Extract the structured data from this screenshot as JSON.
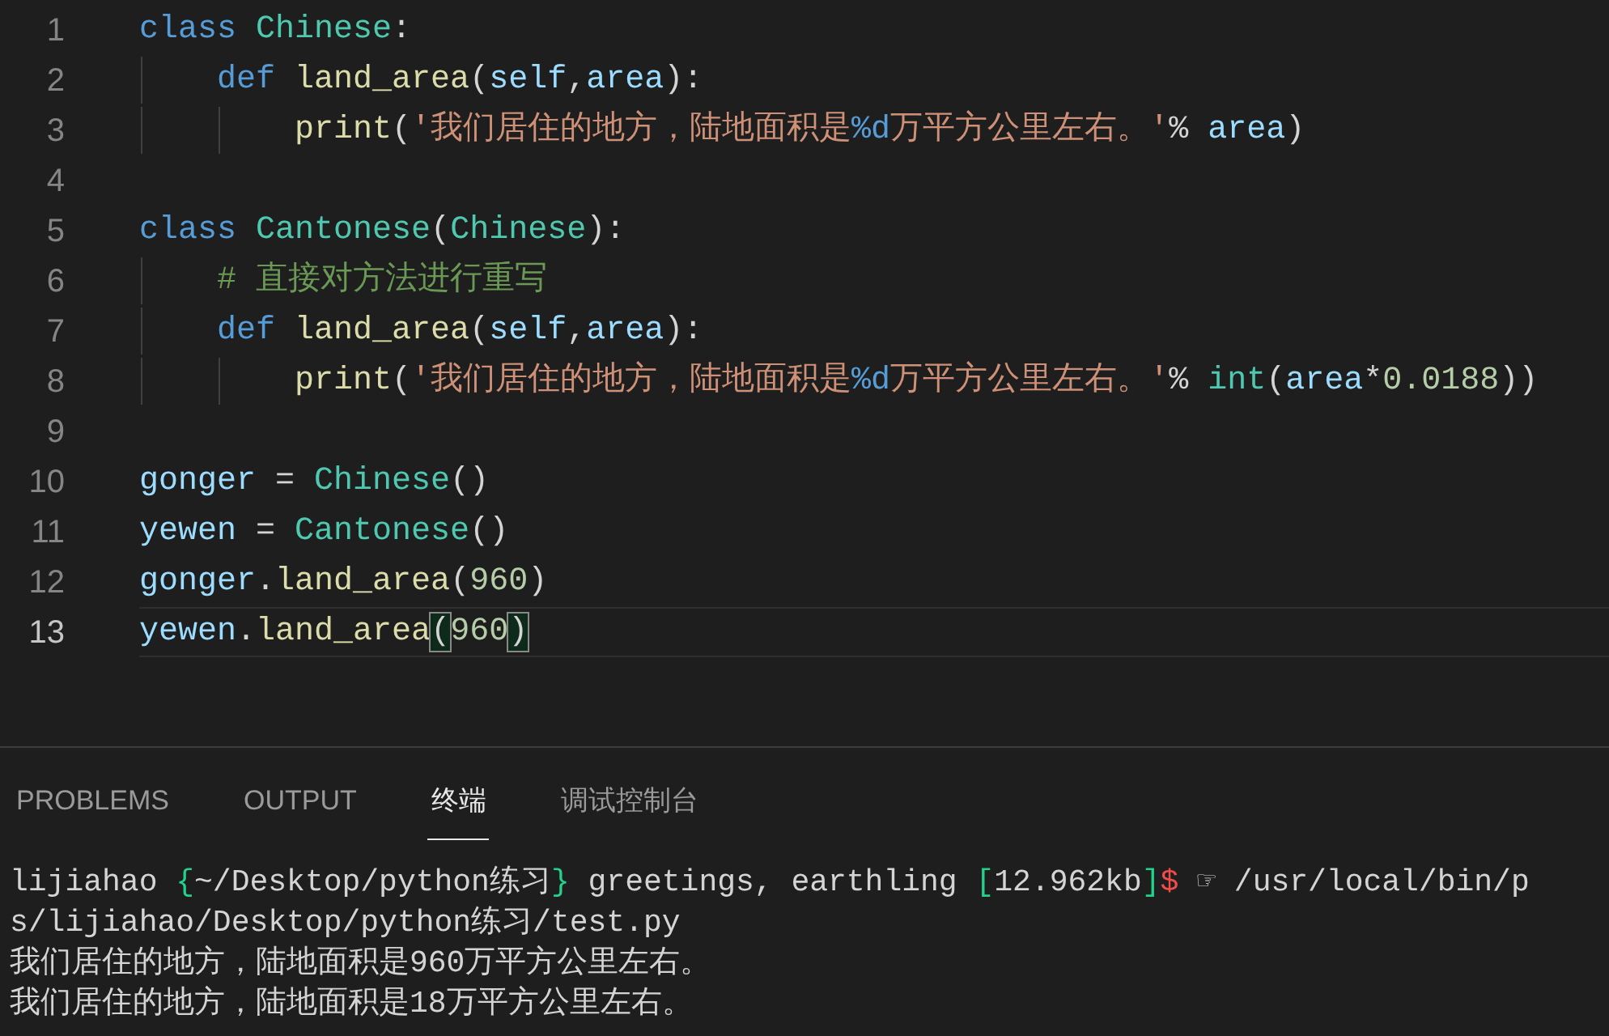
{
  "editor": {
    "lines": [
      {
        "number": "1",
        "current": false,
        "tokens": [
          {
            "text": "class",
            "kind": "keyword"
          },
          {
            "text": " Chinese",
            "kind": "class"
          },
          {
            "text": ":",
            "kind": "plain"
          }
        ],
        "children": [
          {
            "number": "2",
            "current": false,
            "tokens": [
              {
                "text": "def",
                "kind": "keyword"
              },
              {
                "text": " land_area",
                "kind": "func"
              },
              {
                "text": "(",
                "kind": "plain"
              },
              {
                "text": "self",
                "kind": "param"
              },
              {
                "text": ",",
                "kind": "plain"
              },
              {
                "text": "area",
                "kind": "param"
              },
              {
                "text": "):",
                "kind": "plain"
              }
            ],
            "children": [
              {
                "number": "3",
                "current": false,
                "tokens": [
                  {
                    "text": "print",
                    "kind": "func"
                  },
                  {
                    "text": "(",
                    "kind": "plain"
                  },
                  {
                    "text": "'我们居住的地方，陆地面积是",
                    "kind": "string"
                  },
                  {
                    "text": "%d",
                    "kind": "format"
                  },
                  {
                    "text": "万平方公里左右。'",
                    "kind": "string"
                  },
                  {
                    "text": "%",
                    "kind": "plain"
                  },
                  {
                    "text": " area",
                    "kind": "param"
                  },
                  {
                    "text": ")",
                    "kind": "plain"
                  }
                ]
              }
            ]
          }
        ]
      },
      {
        "number": "4",
        "current": false
      },
      {
        "number": "5",
        "current": false,
        "tokens": [
          {
            "text": "class",
            "kind": "keyword"
          },
          {
            "text": " Cantonese",
            "kind": "class"
          },
          {
            "text": "(",
            "kind": "plain"
          },
          {
            "text": "Chinese",
            "kind": "class"
          },
          {
            "text": "):",
            "kind": "plain"
          }
        ],
        "children": [
          {
            "number": "6",
            "current": false,
            "tokens": [
              {
                "text": "# 直接对方法进行重写",
                "kind": "comment"
              }
            ]
          },
          {
            "number": "7",
            "current": false,
            "tokens": [
              {
                "text": "def",
                "kind": "keyword"
              },
              {
                "text": " land_area",
                "kind": "func"
              },
              {
                "text": "(",
                "kind": "plain"
              },
              {
                "text": "self",
                "kind": "param"
              },
              {
                "text": ",",
                "kind": "plain"
              },
              {
                "text": "area",
                "kind": "param"
              },
              {
                "text": "):",
                "kind": "plain"
              }
            ],
            "children": [
              {
                "number": "8",
                "current": false,
                "tokens": [
                  {
                    "text": "print",
                    "kind": "func"
                  },
                  {
                    "text": "(",
                    "kind": "plain"
                  },
                  {
                    "text": "'我们居住的地方，陆地面积是",
                    "kind": "string"
                  },
                  {
                    "text": "%d",
                    "kind": "format"
                  },
                  {
                    "text": "万平方公里左右。'",
                    "kind": "string"
                  },
                  {
                    "text": "%",
                    "kind": "plain"
                  },
                  {
                    "text": " int",
                    "kind": "class"
                  },
                  {
                    "text": "(",
                    "kind": "plain"
                  },
                  {
                    "text": "area",
                    "kind": "param"
                  },
                  {
                    "text": "*",
                    "kind": "plain"
                  },
                  {
                    "text": "0.0188",
                    "kind": "number"
                  },
                  {
                    "text": "))",
                    "kind": "plain"
                  }
                ]
              }
            ]
          }
        ]
      },
      {
        "number": "9",
        "current": false
      },
      {
        "number": "10",
        "current": false,
        "tokens": [
          {
            "text": "gonger",
            "kind": "param"
          },
          {
            "text": " =",
            "kind": "plain"
          },
          {
            "text": " Chinese",
            "kind": "class"
          },
          {
            "text": "()",
            "kind": "plain"
          }
        ]
      },
      {
        "number": "11",
        "current": false,
        "tokens": [
          {
            "text": "yewen",
            "kind": "param"
          },
          {
            "text": " =",
            "kind": "plain"
          },
          {
            "text": " Cantonese",
            "kind": "class"
          },
          {
            "text": "()",
            "kind": "plain"
          }
        ]
      },
      {
        "number": "12",
        "current": false,
        "tokens": [
          {
            "text": "gonger",
            "kind": "param"
          },
          {
            "text": ".",
            "kind": "plain"
          },
          {
            "text": "land_area",
            "kind": "func"
          },
          {
            "text": "(",
            "kind": "plain"
          },
          {
            "text": "960",
            "kind": "number"
          },
          {
            "text": ")",
            "kind": "plain"
          }
        ]
      },
      {
        "number": "13",
        "current": true,
        "tokens": [
          {
            "text": "yewen",
            "kind": "param"
          },
          {
            "text": ".",
            "kind": "plain"
          },
          {
            "text": "land_area",
            "kind": "func"
          },
          {
            "text": "(",
            "kind": "match"
          },
          {
            "text": "960",
            "kind": "number"
          },
          {
            "text": ")",
            "kind": "match"
          }
        ]
      }
    ]
  },
  "panel": {
    "tabs": [
      {
        "label": "PROBLEMS",
        "selected": false
      },
      {
        "label": "OUTPUT",
        "selected": false
      },
      {
        "label": "终端",
        "selected": true
      },
      {
        "label": "调试控制台",
        "selected": false
      }
    ],
    "terminal": [
      [
        {
          "text": "lijiahao",
          "kind": "plain"
        },
        {
          "text": " {",
          "kind": "green"
        },
        {
          "text": "~/Desktop/python练习",
          "kind": "plain"
        },
        {
          "text": "}",
          "kind": "green"
        },
        {
          "text": " greetings, earthling",
          "kind": "plain"
        },
        {
          "text": " [",
          "kind": "green"
        },
        {
          "text": "12.962kb",
          "kind": "plain"
        },
        {
          "text": "]",
          "kind": "green"
        },
        {
          "text": "$",
          "kind": "red"
        },
        {
          "text": " ☞ /usr/local/bin/p",
          "kind": "plain"
        }
      ],
      [
        {
          "text": "s/lijiahao/Desktop/python练习/test.py",
          "kind": "plain"
        }
      ],
      [
        {
          "text": "我们居住的地方，陆地面积是960万平方公里左右。",
          "kind": "plain"
        }
      ],
      [
        {
          "text": "我们居住的地方，陆地面积是18万平方公里左右。",
          "kind": "plain"
        }
      ]
    ]
  }
}
